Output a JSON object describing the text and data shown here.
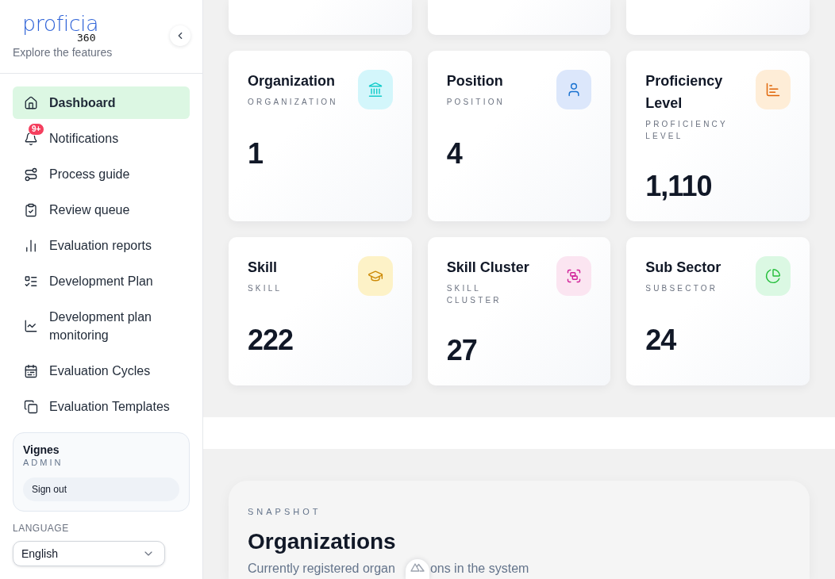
{
  "sidebar": {
    "logo": {
      "wordmark": "proficia",
      "suffix": "360"
    },
    "tagline": "Explore the features",
    "nav_items": [
      {
        "label": "Dashboard",
        "selected": true
      },
      {
        "label": "Notifications",
        "selected": false,
        "badge": "9+"
      },
      {
        "label": "Process guide",
        "selected": false
      },
      {
        "label": "Review queue",
        "selected": false
      },
      {
        "label": "Evaluation reports",
        "selected": false
      },
      {
        "label": "Development Plan",
        "selected": false
      },
      {
        "label": "Development plan monitoring",
        "selected": false
      },
      {
        "label": "Evaluation Cycles",
        "selected": false
      },
      {
        "label": "Evaluation Templates",
        "selected": false
      }
    ],
    "user": {
      "name": "Vignes",
      "role": "ADMIN",
      "sign_out": "Sign out"
    },
    "language": {
      "label": "LANGUAGE",
      "value": "English"
    }
  },
  "stats": [
    {
      "title": "Organization",
      "code": "ORGANIZATION",
      "value": "1",
      "color": "#d3f6fb"
    },
    {
      "title": "Position",
      "code": "POSITION",
      "value": "4",
      "color": "#dce7fb"
    },
    {
      "title": "Proficiency Level",
      "code": "PROFICIENCY LEVEL",
      "value": "1,110",
      "color": "#feedd7"
    },
    {
      "title": "Skill",
      "code": "SKILL",
      "value": "222",
      "color": "#fdf2c7"
    },
    {
      "title": "Skill Cluster",
      "code": "SKILL CLUSTER",
      "value": "27",
      "color": "#fbe5f1"
    },
    {
      "title": "Sub Sector",
      "code": "SUBSECTOR",
      "value": "24",
      "color": "#dbf8e3"
    }
  ],
  "snapshot": {
    "eyebrow": "SNAPSHOT",
    "title": "Organizations",
    "subtitle_parts": [
      "Currently registered organ",
      "ons in the system"
    ]
  }
}
